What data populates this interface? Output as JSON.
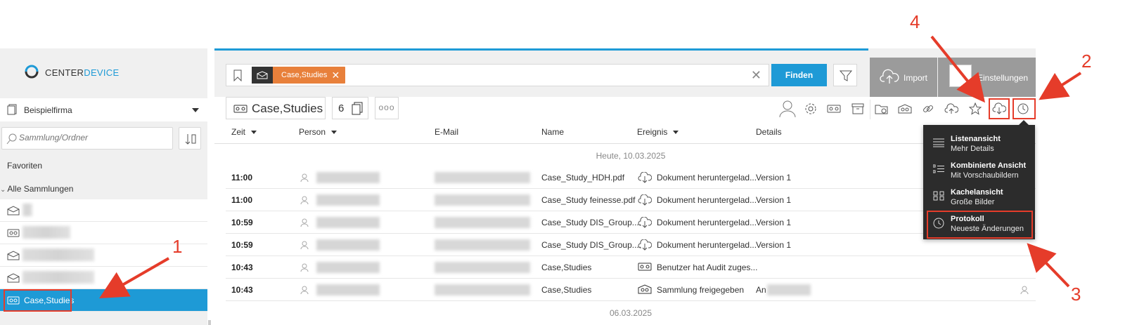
{
  "colors": {
    "accent": "#1e9ad6",
    "chip": "#e8803b",
    "annotation": "#e53c2a",
    "menu_bg": "#2c2c2c"
  },
  "logo": {
    "prefix": "CENTER",
    "suffix": "DEVICE"
  },
  "sidebar": {
    "company": "Beispielfirma",
    "search_placeholder": "Sammlung/Ordner",
    "favorites_label": "Favoriten",
    "all_collections_label": "Alle Sammlungen",
    "active_collection": "Case,Studies"
  },
  "search": {
    "chip_label": "Case,Studies",
    "find_label": "Finden"
  },
  "header": {
    "import_label": "Import",
    "settings_label": "Einstellungen"
  },
  "collection": {
    "title": "Case,Studies",
    "doc_count": "6",
    "more": "ooo"
  },
  "table": {
    "columns": [
      "Zeit",
      "Person",
      "E-Mail",
      "Name",
      "Ereignis",
      "Details"
    ],
    "day_today": "Heute, 10.03.2025",
    "day_prev": "06.03.2025",
    "rows": [
      {
        "time": "11:00",
        "name": "Case_Study_HDH.pdf",
        "event": "Dokument heruntergelad...",
        "details": "Version 1",
        "event_icon": "cloud-download-icon"
      },
      {
        "time": "11:00",
        "name": "Case_Study feinesse.pdf",
        "event": "Dokument heruntergelad...",
        "details": "Version 1",
        "event_icon": "cloud-download-icon"
      },
      {
        "time": "10:59",
        "name": "Case_Study DIS_Group....",
        "event": "Dokument heruntergelad...",
        "details": "Version 1",
        "event_icon": "cloud-download-icon"
      },
      {
        "time": "10:59",
        "name": "Case_Study DIS_Group....",
        "event": "Dokument heruntergelad...",
        "details": "Version 1",
        "event_icon": "cloud-download-icon"
      },
      {
        "time": "10:43",
        "name": "Case,Studies",
        "event": "Benutzer hat Audit zuges...",
        "details": "",
        "event_icon": "collection-icon"
      },
      {
        "time": "10:43",
        "name": "Case,Studies",
        "event": "Sammlung freigegeben",
        "details": "An",
        "event_icon": "share-collection-icon"
      }
    ]
  },
  "view_menu": {
    "items": [
      {
        "title": "Listenansicht",
        "subtitle": "Mehr Details",
        "icon": "list-icon"
      },
      {
        "title": "Kombinierte Ansicht",
        "subtitle": "Mit Vorschaubildern",
        "icon": "combined-list-icon"
      },
      {
        "title": "Kachelansicht",
        "subtitle": "Große Bilder",
        "icon": "tiles-icon"
      },
      {
        "title": "Protokoll",
        "subtitle": "Neueste Änderungen",
        "icon": "clock-icon"
      }
    ]
  },
  "annotations": [
    "1",
    "2",
    "3",
    "4"
  ]
}
